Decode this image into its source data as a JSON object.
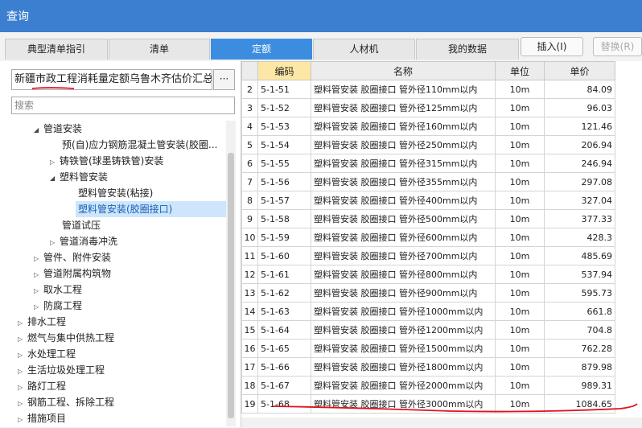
{
  "window": {
    "title": "查询"
  },
  "tabs": [
    "典型清单指引",
    "清单",
    "定额",
    "人材机",
    "我的数据"
  ],
  "active_tab": "定额",
  "buttons": {
    "insert": "插入(I)",
    "replace": "替换(R)"
  },
  "library": {
    "selected": "新疆市政工程消耗量定额乌鲁木齐估价汇总表(",
    "more": "···"
  },
  "search": {
    "placeholder": "搜索"
  },
  "tree": [
    {
      "label": "管道安装",
      "expanded": true
    },
    {
      "label": "预(自)应力钢筋混凝土管安装(胶圈..."
    },
    {
      "label": "铸铁管(球墨铸铁管)安装"
    },
    {
      "label": "塑料管安装",
      "expanded": true
    },
    {
      "label": "塑料管安装(粘接)"
    },
    {
      "label": "塑料管安装(胶圈接口)",
      "selected": true
    },
    {
      "label": "管道试压"
    },
    {
      "label": "管道消毒冲洗"
    },
    {
      "label": "管件、附件安装"
    },
    {
      "label": "管道附属构筑物"
    },
    {
      "label": "取水工程"
    },
    {
      "label": "防腐工程"
    },
    {
      "label": "排水工程"
    },
    {
      "label": "燃气与集中供热工程"
    },
    {
      "label": "水处理工程"
    },
    {
      "label": "生活垃圾处理工程"
    },
    {
      "label": "路灯工程"
    },
    {
      "label": "钢筋工程、拆除工程"
    },
    {
      "label": "措施项目"
    }
  ],
  "table": {
    "columns": [
      "编码",
      "名称",
      "单位",
      "单价"
    ],
    "rows": [
      {
        "n": "2",
        "code": "5-1-51",
        "name": "塑料管安装 胶圈接口 管外径110mm以内",
        "unit": "10m",
        "price": "84.09"
      },
      {
        "n": "3",
        "code": "5-1-52",
        "name": "塑料管安装 胶圈接口 管外径125mm以内",
        "unit": "10m",
        "price": "96.03"
      },
      {
        "n": "4",
        "code": "5-1-53",
        "name": "塑料管安装 胶圈接口 管外径160mm以内",
        "unit": "10m",
        "price": "121.46"
      },
      {
        "n": "5",
        "code": "5-1-54",
        "name": "塑料管安装 胶圈接口 管外径250mm以内",
        "unit": "10m",
        "price": "206.94"
      },
      {
        "n": "6",
        "code": "5-1-55",
        "name": "塑料管安装 胶圈接口 管外径315mm以内",
        "unit": "10m",
        "price": "246.94"
      },
      {
        "n": "7",
        "code": "5-1-56",
        "name": "塑料管安装 胶圈接口 管外径355mm以内",
        "unit": "10m",
        "price": "297.08"
      },
      {
        "n": "8",
        "code": "5-1-57",
        "name": "塑料管安装 胶圈接口 管外径400mm以内",
        "unit": "10m",
        "price": "327.04"
      },
      {
        "n": "9",
        "code": "5-1-58",
        "name": "塑料管安装 胶圈接口 管外径500mm以内",
        "unit": "10m",
        "price": "377.33"
      },
      {
        "n": "10",
        "code": "5-1-59",
        "name": "塑料管安装 胶圈接口 管外径600mm以内",
        "unit": "10m",
        "price": "428.3"
      },
      {
        "n": "11",
        "code": "5-1-60",
        "name": "塑料管安装 胶圈接口 管外径700mm以内",
        "unit": "10m",
        "price": "485.69"
      },
      {
        "n": "12",
        "code": "5-1-61",
        "name": "塑料管安装 胶圈接口 管外径800mm以内",
        "unit": "10m",
        "price": "537.94"
      },
      {
        "n": "13",
        "code": "5-1-62",
        "name": "塑料管安装 胶圈接口 管外径900mm以内",
        "unit": "10m",
        "price": "595.73"
      },
      {
        "n": "14",
        "code": "5-1-63",
        "name": "塑料管安装 胶圈接口 管外径1000mm以内",
        "unit": "10m",
        "price": "661.8"
      },
      {
        "n": "15",
        "code": "5-1-64",
        "name": "塑料管安装 胶圈接口 管外径1200mm以内",
        "unit": "10m",
        "price": "704.8"
      },
      {
        "n": "16",
        "code": "5-1-65",
        "name": "塑料管安装 胶圈接口 管外径1500mm以内",
        "unit": "10m",
        "price": "762.28"
      },
      {
        "n": "17",
        "code": "5-1-66",
        "name": "塑料管安装 胶圈接口 管外径1800mm以内",
        "unit": "10m",
        "price": "879.98"
      },
      {
        "n": "18",
        "code": "5-1-67",
        "name": "塑料管安装 胶圈接口 管外径2000mm以内",
        "unit": "10m",
        "price": "989.31"
      },
      {
        "n": "19",
        "code": "5-1-68",
        "name": "塑料管安装 胶圈接口 管外径3000mm以内",
        "unit": "10m",
        "price": "1084.65"
      }
    ]
  },
  "colors": {
    "title_bar": "#3c7fd0",
    "active_tab": "#3c8de0",
    "selection": "#cde6fb",
    "annotation": "#e0121d"
  }
}
